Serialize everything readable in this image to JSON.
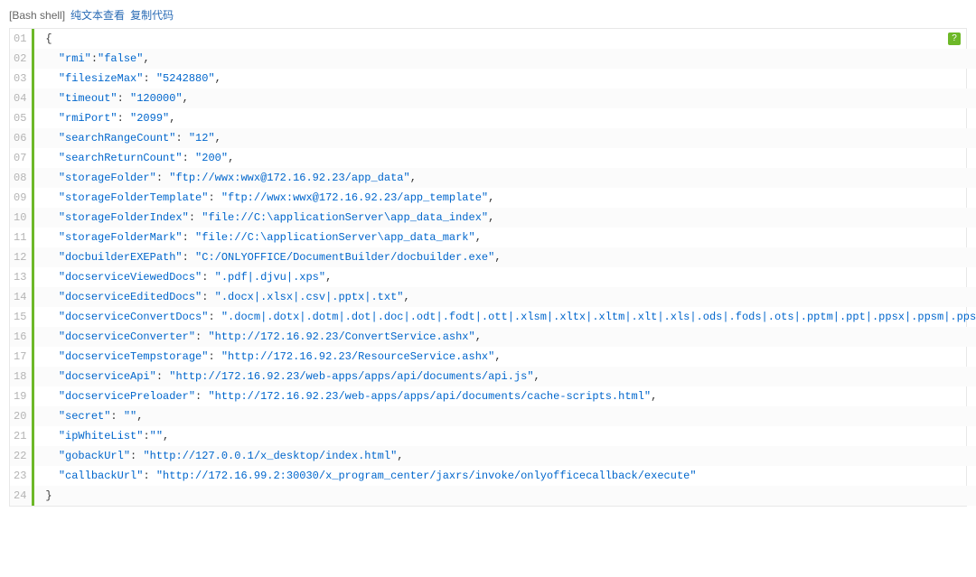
{
  "header": {
    "lang_label": "[Bash shell]",
    "btn_plain": "纯文本查看",
    "btn_copy": "复制代码"
  },
  "help_icon": "?",
  "code": {
    "lines": [
      {
        "no": "01",
        "indent": 0,
        "prefix": "{",
        "key": null,
        "val": null,
        "trail": ""
      },
      {
        "no": "02",
        "indent": 1,
        "prefix": "",
        "key": "\"rmi\"",
        "sep": ":",
        "val": "\"false\"",
        "trail": ","
      },
      {
        "no": "03",
        "indent": 1,
        "prefix": "",
        "key": "\"filesizeMax\"",
        "sep": ": ",
        "val": "\"5242880\"",
        "trail": ","
      },
      {
        "no": "04",
        "indent": 1,
        "prefix": "",
        "key": "\"timeout\"",
        "sep": ": ",
        "val": "\"120000\"",
        "trail": ","
      },
      {
        "no": "05",
        "indent": 1,
        "prefix": "",
        "key": "\"rmiPort\"",
        "sep": ": ",
        "val": "\"2099\"",
        "trail": ","
      },
      {
        "no": "06",
        "indent": 1,
        "prefix": "",
        "key": "\"searchRangeCount\"",
        "sep": ": ",
        "val": "\"12\"",
        "trail": ","
      },
      {
        "no": "07",
        "indent": 1,
        "prefix": "",
        "key": "\"searchReturnCount\"",
        "sep": ": ",
        "val": "\"200\"",
        "trail": ","
      },
      {
        "no": "08",
        "indent": 1,
        "prefix": "",
        "key": "\"storageFolder\"",
        "sep": ": ",
        "val": "\"ftp://wwx:wwx@172.16.92.23/app_data\"",
        "trail": ","
      },
      {
        "no": "09",
        "indent": 1,
        "prefix": "",
        "key": "\"storageFolderTemplate\"",
        "sep": ": ",
        "val": "\"ftp://wwx:wwx@172.16.92.23/app_template\"",
        "trail": ","
      },
      {
        "no": "10",
        "indent": 1,
        "prefix": "",
        "key": "\"storageFolderIndex\"",
        "sep": ": ",
        "val": "\"file://C:\\applicationServer\\app_data_index\"",
        "trail": ","
      },
      {
        "no": "11",
        "indent": 1,
        "prefix": "",
        "key": "\"storageFolderMark\"",
        "sep": ": ",
        "val": "\"file://C:\\applicationServer\\app_data_mark\"",
        "trail": ","
      },
      {
        "no": "12",
        "indent": 1,
        "prefix": "",
        "key": "\"docbuilderEXEPath\"",
        "sep": ": ",
        "val": "\"C:/ONLYOFFICE/DocumentBuilder/docbuilder.exe\"",
        "trail": ","
      },
      {
        "no": "13",
        "indent": 1,
        "prefix": "",
        "key": "\"docserviceViewedDocs\"",
        "sep": ": ",
        "val": "\".pdf|.djvu|.xps\"",
        "trail": ","
      },
      {
        "no": "14",
        "indent": 1,
        "prefix": "",
        "key": "\"docserviceEditedDocs\"",
        "sep": ": ",
        "val": "\".docx|.xlsx|.csv|.pptx|.txt\"",
        "trail": ","
      },
      {
        "no": "15",
        "indent": 1,
        "prefix": "",
        "key": "\"docserviceConvertDocs\"",
        "sep": ": ",
        "val": "\".docm|.dotx|.dotm|.dot|.doc|.odt|.fodt|.ott|.xlsm|.xltx|.xltm|.xlt|.xls|.ods|.fods|.ots|.pptm|.ppt|.ppsx|.ppsm|.pps|.pot",
        "trail": ""
      },
      {
        "no": "16",
        "indent": 1,
        "prefix": "",
        "key": "\"docserviceConverter\"",
        "sep": ": ",
        "val": "\"http://172.16.92.23/ConvertService.ashx\"",
        "trail": ","
      },
      {
        "no": "17",
        "indent": 1,
        "prefix": "",
        "key": "\"docserviceTempstorage\"",
        "sep": ": ",
        "val": "\"http://172.16.92.23/ResourceService.ashx\"",
        "trail": ","
      },
      {
        "no": "18",
        "indent": 1,
        "prefix": "",
        "key": "\"docserviceApi\"",
        "sep": ": ",
        "val": "\"http://172.16.92.23/web-apps/apps/api/documents/api.js\"",
        "trail": ","
      },
      {
        "no": "19",
        "indent": 1,
        "prefix": "",
        "key": "\"docservicePreloader\"",
        "sep": ": ",
        "val": "\"http://172.16.92.23/web-apps/apps/api/documents/cache-scripts.html\"",
        "trail": ","
      },
      {
        "no": "20",
        "indent": 1,
        "prefix": "",
        "key": "\"secret\"",
        "sep": ": ",
        "val": "\"\"",
        "trail": ","
      },
      {
        "no": "21",
        "indent": 1,
        "prefix": "",
        "key": "\"ipWhiteList\"",
        "sep": ":",
        "val": "\"\"",
        "trail": ","
      },
      {
        "no": "22",
        "indent": 1,
        "prefix": "",
        "key": "\"gobackUrl\"",
        "sep": ": ",
        "val": "\"http://127.0.0.1/x_desktop/index.html\"",
        "trail": ","
      },
      {
        "no": "23",
        "indent": 1,
        "prefix": "",
        "key": "\"callbackUrl\"",
        "sep": ": ",
        "val": "\"http://172.16.99.2:30030/x_program_center/jaxrs/invoke/onlyofficecallback/execute\"",
        "trail": ""
      },
      {
        "no": "24",
        "indent": 0,
        "prefix": "}",
        "key": null,
        "val": null,
        "trail": ""
      }
    ]
  }
}
